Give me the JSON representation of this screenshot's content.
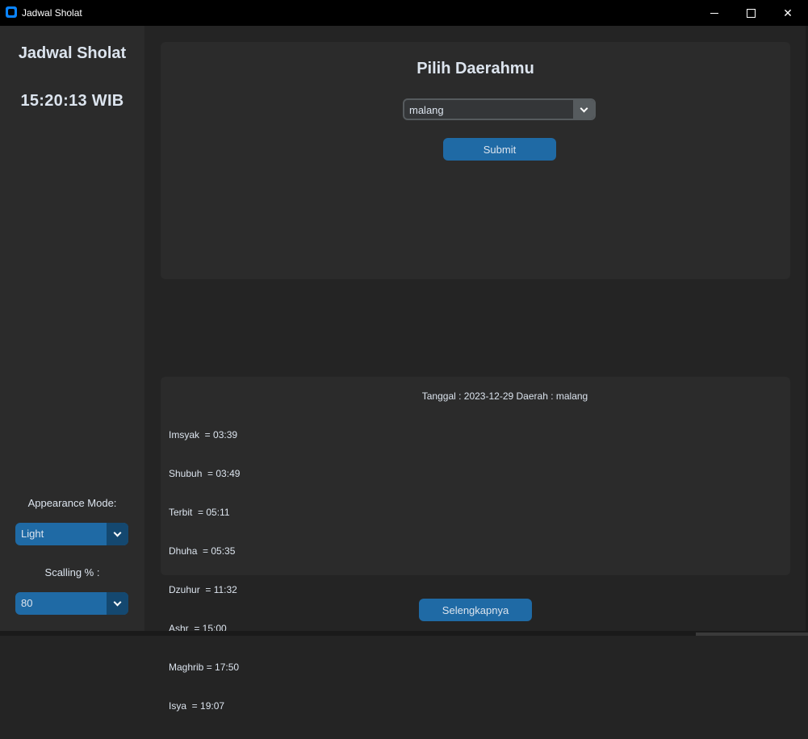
{
  "window": {
    "title": "Jadwal Sholat"
  },
  "sidebar": {
    "title": "Jadwal Sholat",
    "clock": "15:20:13  WIB",
    "appearance_label": "Appearance Mode:",
    "appearance_value": "Light",
    "scaling_label": "Scalling % :",
    "scaling_value": "80"
  },
  "region": {
    "title": "Pilih Daerahmu",
    "selected": "malang",
    "submit_label": "Submit"
  },
  "schedule": {
    "header": "Tanggal : 2023-12-29 Daerah : malang",
    "times": [
      "Imsyak  = 03:39",
      "Shubuh  = 03:49",
      "Terbit  = 05:11",
      "Dhuha  = 05:35",
      "Dzuhur  = 11:32",
      "Ashr  = 15:00",
      "Maghrib = 17:50",
      "Isya  = 19:07"
    ]
  },
  "more_label": "Selengkapnya",
  "colors": {
    "accent": "#1f6aa5",
    "accent_dark": "#144870",
    "background": "#242424",
    "panel": "#2b2b2b",
    "text": "#dce4ee"
  }
}
